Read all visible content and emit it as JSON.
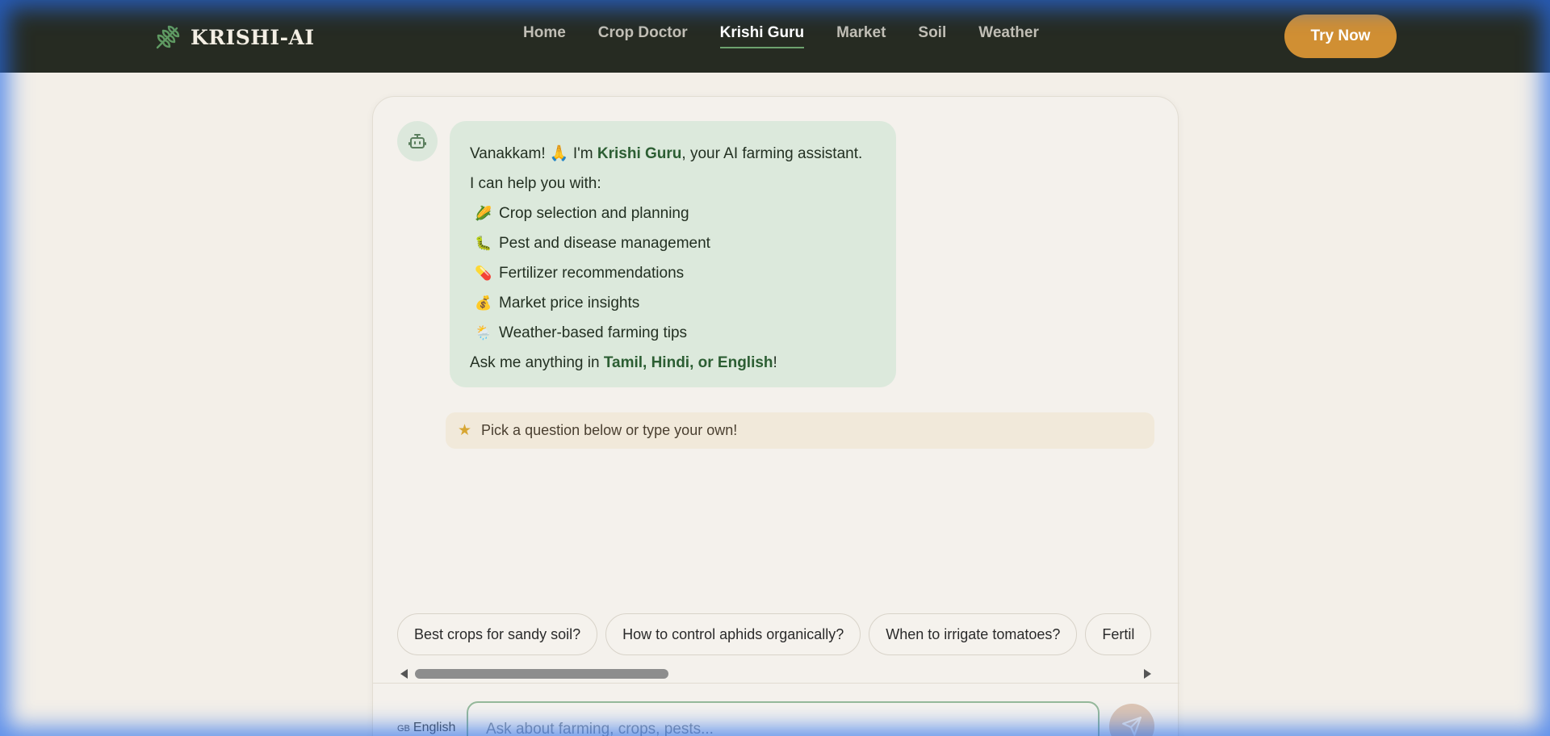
{
  "brand": {
    "name": "KRISHI-AI",
    "icon": "wheat-icon"
  },
  "nav": {
    "links": [
      "Home",
      "Crop Doctor",
      "Krishi Guru",
      "Market",
      "Soil",
      "Weather"
    ],
    "active": "Krishi Guru",
    "cta": "Try Now"
  },
  "chat": {
    "bot_icon": "robot-icon",
    "greeting_pre": "Vanakkam! ",
    "greeting_emoji": "🙏",
    "greeting_mid": " I'm ",
    "bot_name": "Krishi Guru",
    "greeting_post": ", your AI farming assistant.",
    "help_intro": "I can help you with:",
    "capabilities": [
      {
        "emoji": "🌽",
        "text": "Crop selection and planning"
      },
      {
        "emoji": "🐛",
        "text": "Pest and disease management"
      },
      {
        "emoji": "💊",
        "text": "Fertilizer recommendations"
      },
      {
        "emoji": "💰",
        "text": "Market price insights"
      },
      {
        "emoji": "🌦️",
        "text": "Weather-based farming tips"
      }
    ],
    "ask_pre": "Ask me anything in ",
    "ask_langs": "Tamil, Hindi, or English",
    "ask_post": "!",
    "hint": "Pick a question below or type your own!",
    "suggestions": [
      "Best crops for sandy soil?",
      "How to control aphids organically?",
      "When to irrigate tomatoes?",
      "Fertil"
    ],
    "language_flag": "GB",
    "language": "English",
    "input_placeholder": "Ask about farming, crops, pests...",
    "send_icon": "send-icon"
  },
  "colors": {
    "nav_bg": "#262b22",
    "accent": "#d08f33",
    "bot_bubble": "#dce9dc",
    "highlight_text": "#2c5e33"
  }
}
